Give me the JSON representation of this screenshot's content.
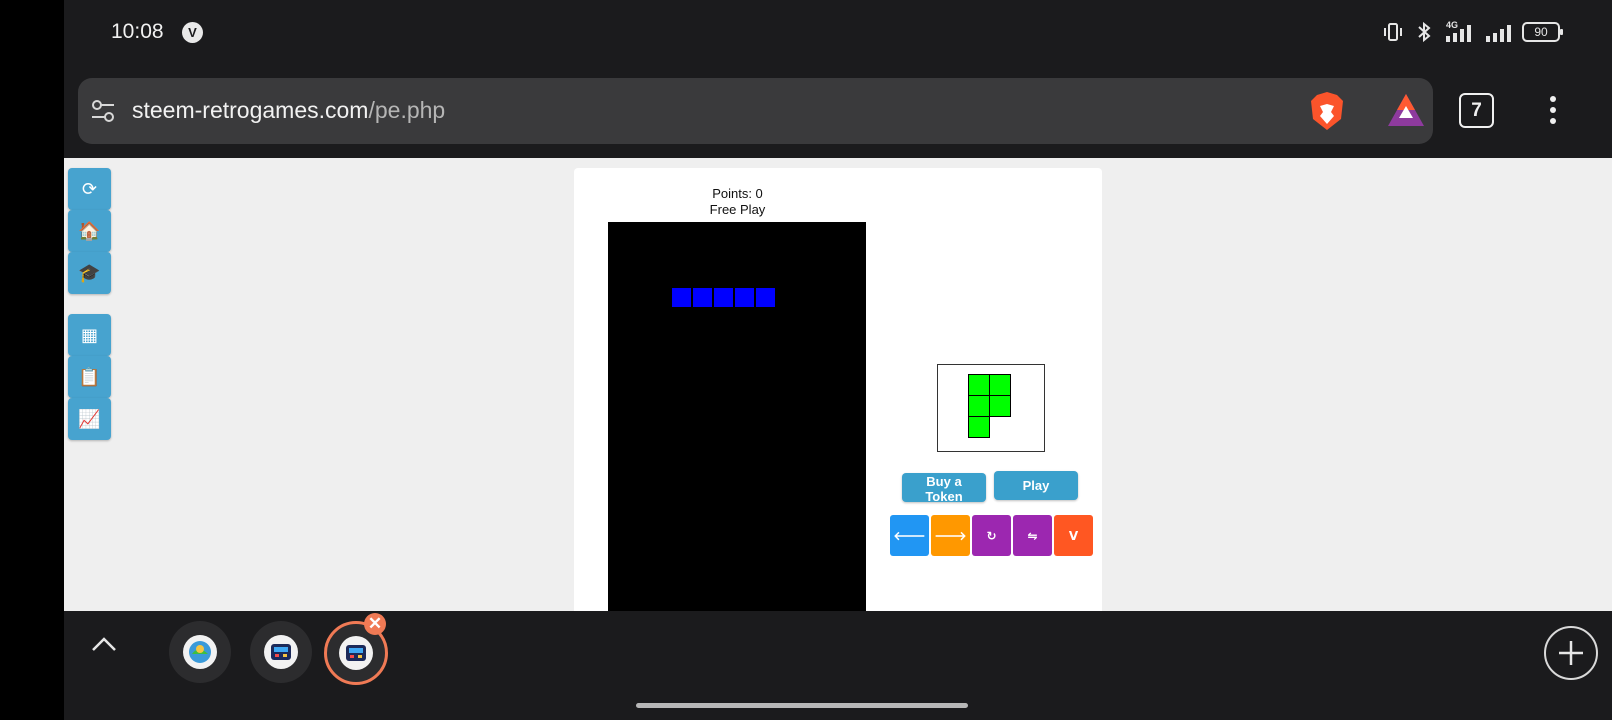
{
  "status_bar": {
    "time": "10:08",
    "vpn_badge": "V",
    "network_type": "4G",
    "battery": "90"
  },
  "browser": {
    "url_domain": "steem-retrogames.com",
    "url_path": "/pe.php",
    "tab_count": "7"
  },
  "side_nav": {
    "items": [
      {
        "icon": "refresh-icon",
        "glyph": "⟳"
      },
      {
        "icon": "home-icon",
        "glyph": "🏠"
      },
      {
        "icon": "graduation-cap-icon",
        "glyph": "🎓"
      },
      {
        "icon": "calculator-icon",
        "glyph": "▦"
      },
      {
        "icon": "clipboard-icon",
        "glyph": "📋"
      },
      {
        "icon": "chart-icon",
        "glyph": "📈"
      }
    ]
  },
  "game": {
    "points_label": "Points: 0",
    "mode_label": "Free Play",
    "falling_piece_color": "#0000ff",
    "next_piece_color": "#00ff00",
    "buy_token_label": "Buy a Token",
    "play_label": "Play",
    "controls": [
      {
        "name": "move-left-button",
        "glyph": "🡐",
        "color": "#2196f3"
      },
      {
        "name": "move-right-button",
        "glyph": "🡒",
        "color": "#ff9800"
      },
      {
        "name": "rotate-button",
        "glyph": "↻",
        "color": "#9c27b0"
      },
      {
        "name": "flip-button",
        "glyph": "⇋",
        "color": "#9c27b0"
      },
      {
        "name": "drop-button",
        "glyph": "V",
        "color": "#ff5722"
      }
    ]
  },
  "tabs": {
    "close_label": "✕"
  },
  "colors": {
    "nav_button": "#47a3cf",
    "accent_tab": "#f07a55"
  }
}
